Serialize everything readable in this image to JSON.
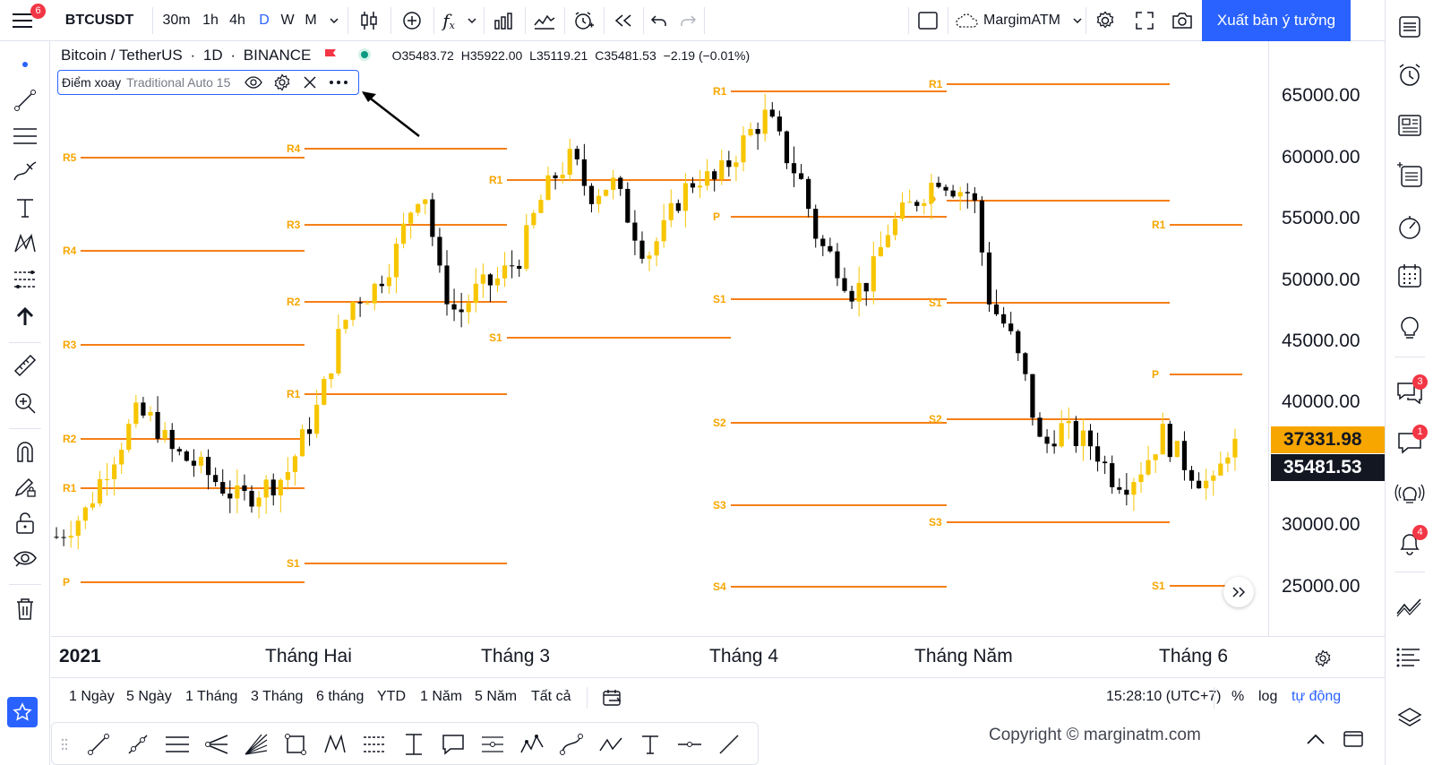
{
  "toolbar": {
    "menu_badge": "6",
    "symbol": "BTCUSDT",
    "intervals": [
      "30m",
      "1h",
      "4h",
      "D",
      "W",
      "M"
    ],
    "active_interval": "D",
    "layout_name": "MargimATM",
    "publish_button": "Xuất bản ý tưởng"
  },
  "legend": {
    "pair": "Bitcoin / TetherUS",
    "timeframe": "1D",
    "exchange": "BINANCE",
    "o_label": "O",
    "o": "35483.72",
    "h_label": "H",
    "h": "35922.00",
    "l_label": "L",
    "l": "35119.21",
    "c_label": "C",
    "c": "35481.53",
    "change": "−2.19 (−0.01%)"
  },
  "indicator": {
    "name": "Điểm xoay",
    "params": "Traditional Auto 15"
  },
  "price_scale": {
    "ticks": [
      "65000.00",
      "60000.00",
      "55000.00",
      "50000.00",
      "45000.00",
      "40000.00",
      "30000.00",
      "25000.00"
    ],
    "pivot_label": "37331.98",
    "last_price": "35481.53"
  },
  "time_scale": {
    "ticks": [
      "2021",
      "Tháng Hai",
      "Tháng 3",
      "Tháng 4",
      "Tháng Năm",
      "Tháng 6"
    ]
  },
  "range_bar": {
    "ranges": [
      "1 Ngày",
      "5 Ngày",
      "1 Tháng",
      "3 Tháng",
      "6 tháng",
      "YTD",
      "1 Năm",
      "5 Năm",
      "Tất cả"
    ],
    "clock": "15:28:10 (UTC+7)",
    "percent": "%",
    "log": "log",
    "auto": "tự động"
  },
  "copyright": "Copyright © marginatm.com",
  "right_badges": {
    "chat": "3",
    "messages": "1",
    "alerts": "4"
  },
  "pivot_levels": [
    {
      "label": "R5",
      "period": 0
    },
    {
      "label": "R4",
      "period": 0
    },
    {
      "label": "R3",
      "period": 0
    },
    {
      "label": "R2",
      "period": 0
    },
    {
      "label": "R1",
      "period": 0
    },
    {
      "label": "P",
      "period": 0
    },
    {
      "label": "R4",
      "period": 1
    },
    {
      "label": "R3",
      "period": 1
    },
    {
      "label": "R2",
      "period": 1
    },
    {
      "label": "R1",
      "period": 1
    },
    {
      "label": "S1",
      "period": 1
    },
    {
      "label": "R1",
      "period": 2
    },
    {
      "label": "S1",
      "period": 2
    },
    {
      "label": "R1",
      "period": 3
    },
    {
      "label": "P",
      "period": 3
    },
    {
      "label": "S1",
      "period": 3
    },
    {
      "label": "S2",
      "period": 3
    },
    {
      "label": "S3",
      "period": 3
    },
    {
      "label": "S4",
      "period": 3
    },
    {
      "label": "R1",
      "period": 4
    },
    {
      "label": "P",
      "period": 4
    },
    {
      "label": "S1",
      "period": 4
    },
    {
      "label": "S2",
      "period": 4
    },
    {
      "label": "S3",
      "period": 4
    },
    {
      "label": "R1",
      "period": 5
    },
    {
      "label": "P",
      "period": 5
    },
    {
      "label": "S1",
      "period": 5
    }
  ],
  "colors": {
    "bull": "#f7c600",
    "bear": "#000000",
    "pivot": "#f57f17",
    "accent": "#2962ff",
    "pivot_label_bg": "#f7a600"
  }
}
